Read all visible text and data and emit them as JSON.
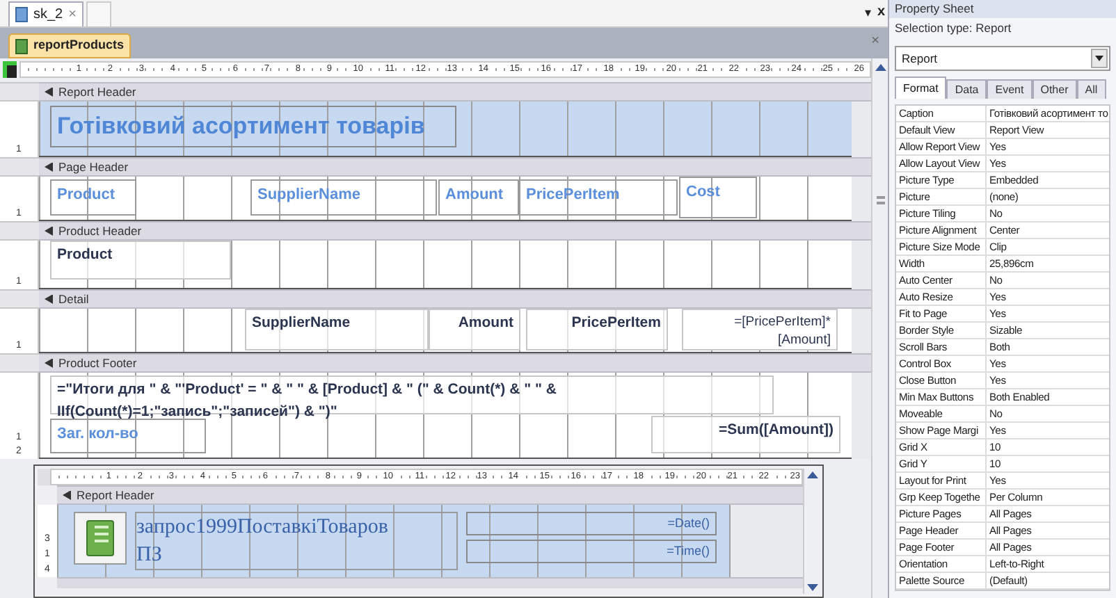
{
  "doc_tabs": [
    {
      "label": "sk_2",
      "close": "×",
      "selected": true
    }
  ],
  "tab_strip": {
    "menu": "▾",
    "close": "x"
  },
  "report_tab": {
    "title": "reportProducts",
    "close": "×"
  },
  "ruler": [
    "1",
    "2",
    "3",
    "4",
    "5",
    "6",
    "7",
    "8",
    "9",
    "10",
    "11",
    "12",
    "13",
    "14",
    "15",
    "16",
    "17",
    "18",
    "19",
    "20",
    "21",
    "22",
    "23",
    "24",
    "25",
    "26"
  ],
  "sections": [
    {
      "title": "Report Header",
      "shaded": true,
      "vruler": [
        "1"
      ],
      "controls": [
        {
          "kind": "title",
          "text": "Готівковий асортимент товарів"
        }
      ]
    },
    {
      "title": "Page Header",
      "shaded": false,
      "vruler": [
        "1"
      ],
      "controls": [
        {
          "kind": "label",
          "text": "Product"
        },
        {
          "kind": "label",
          "text": "SupplierName"
        },
        {
          "kind": "label",
          "text": "Amount"
        },
        {
          "kind": "label",
          "text": "PricePerItem"
        },
        {
          "kind": "label",
          "text": "Cost"
        }
      ]
    },
    {
      "title": "Product Header",
      "shaded": false,
      "vruler": [
        "1"
      ],
      "controls": [
        {
          "kind": "field",
          "text": "Product"
        }
      ]
    },
    {
      "title": "Detail",
      "shaded": false,
      "vruler": [
        "1"
      ],
      "controls": [
        {
          "kind": "field",
          "text": "SupplierName"
        },
        {
          "kind": "field",
          "text": "Amount"
        },
        {
          "kind": "field",
          "text": "PricePerItem"
        },
        {
          "kind": "expression",
          "text": "=[PricePerItem]*[Amount]"
        }
      ]
    },
    {
      "title": "Product Footer",
      "shaded": false,
      "vruler": [
        "1",
        "2"
      ],
      "controls": [
        {
          "kind": "field",
          "text": "=\"Итоги для \" & \"'Product' = \" & \" \" & [Product] & \" (\" & Count(*) & \" \" & IIf(Count(*)=1;\"запись\";\"записей\") & \")\""
        },
        {
          "kind": "label",
          "text": "Заг. кол-во"
        },
        {
          "kind": "field",
          "text": "=Sum([Amount])"
        }
      ]
    }
  ],
  "subreport": {
    "ruler": [
      "1",
      "2",
      "3",
      "4",
      "5",
      "6",
      "7",
      "8",
      "9",
      "10",
      "11",
      "12",
      "13",
      "14",
      "15",
      "16",
      "17",
      "18",
      "19",
      "20",
      "21",
      "22",
      "23"
    ],
    "vruler": [
      "3",
      "1",
      "4"
    ],
    "section": "Report Header",
    "title": "запрос1999ПоставкіТоваров",
    "title_line2": "ПЗ",
    "date": "=Date()",
    "time": "=Time()"
  },
  "property_sheet": {
    "title": "Property Sheet",
    "selection_type": "Selection type:  Report",
    "object": "Report",
    "tabs": [
      {
        "label": "Format",
        "selected": true
      },
      {
        "label": "Data",
        "selected": false
      },
      {
        "label": "Event",
        "selected": false
      },
      {
        "label": "Other",
        "selected": false
      },
      {
        "label": "All",
        "selected": false
      }
    ],
    "properties": [
      {
        "name": "Caption",
        "value": "Готівковий асортимент то"
      },
      {
        "name": "Default View",
        "value": "Report View"
      },
      {
        "name": "Allow Report View",
        "value": "Yes"
      },
      {
        "name": "Allow Layout View",
        "value": "Yes"
      },
      {
        "name": "Picture Type",
        "value": "Embedded"
      },
      {
        "name": "Picture",
        "value": "(none)"
      },
      {
        "name": "Picture Tiling",
        "value": "No"
      },
      {
        "name": "Picture Alignment",
        "value": "Center"
      },
      {
        "name": "Picture Size Mode",
        "value": "Clip"
      },
      {
        "name": "Width",
        "value": "25,896cm"
      },
      {
        "name": "Auto Center",
        "value": "No"
      },
      {
        "name": "Auto Resize",
        "value": "Yes"
      },
      {
        "name": "Fit to Page",
        "value": "Yes"
      },
      {
        "name": "Border Style",
        "value": "Sizable"
      },
      {
        "name": "Scroll Bars",
        "value": "Both"
      },
      {
        "name": "Control Box",
        "value": "Yes"
      },
      {
        "name": "Close Button",
        "value": "Yes"
      },
      {
        "name": "Min Max Buttons",
        "value": "Both Enabled"
      },
      {
        "name": "Moveable",
        "value": "No"
      },
      {
        "name": "Show Page Margi",
        "value": "Yes"
      },
      {
        "name": "Grid X",
        "value": "10"
      },
      {
        "name": "Grid Y",
        "value": "10"
      },
      {
        "name": "Layout for Print",
        "value": "Yes"
      },
      {
        "name": "Grp Keep Togethe",
        "value": "Per Column"
      },
      {
        "name": "Picture Pages",
        "value": "All Pages"
      },
      {
        "name": "Page Header",
        "value": "All Pages"
      },
      {
        "name": "Page Footer",
        "value": "All Pages"
      },
      {
        "name": "Orientation",
        "value": "Left-to-Right"
      },
      {
        "name": "Palette Source",
        "value": "(Default)"
      }
    ]
  }
}
